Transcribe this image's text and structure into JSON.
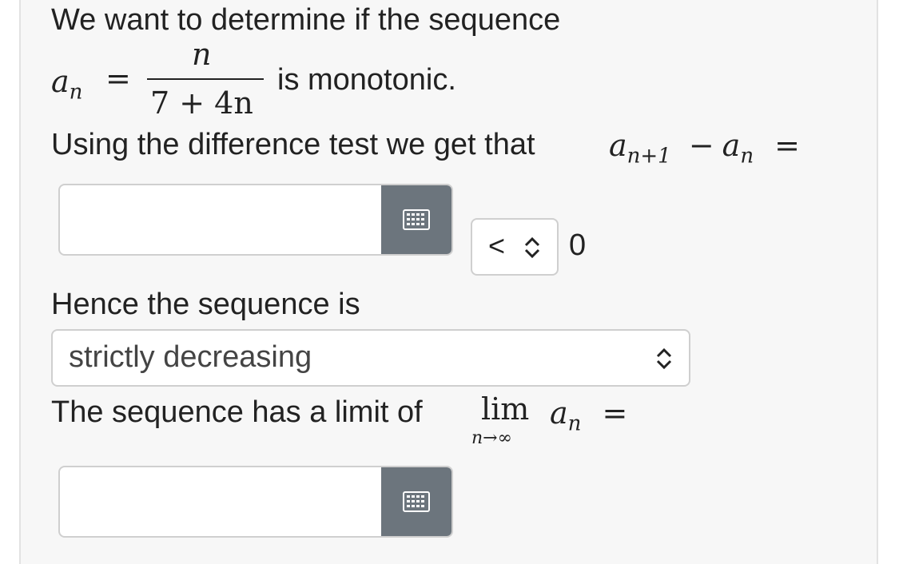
{
  "question": {
    "intro": "We want to determine if the sequence",
    "formula": {
      "lhs": "a",
      "lhs_sub": "n",
      "equals": "=",
      "numerator": "n",
      "denominator": "7 + 4n"
    },
    "monotonic_text": "is monotonic.",
    "difference_text": "Using the difference test we get that",
    "difference_expr": {
      "a1": "a",
      "a1_sub": "n+1",
      "minus": "−",
      "a2": "a",
      "a2_sub": "n",
      "equals": "="
    },
    "answer1": {
      "value": "",
      "placeholder": ""
    },
    "comparison": {
      "selected": "<",
      "right_value": "0"
    },
    "hence_text": "Hence the sequence is",
    "sequence_select": {
      "selected": "strictly decreasing"
    },
    "limit_text": "The sequence has a limit of",
    "limit_expr": {
      "lim": "lim",
      "under": "n→∞",
      "a": "a",
      "a_sub": "n",
      "equals": "="
    },
    "answer2": {
      "value": "",
      "placeholder": ""
    }
  },
  "icons": {
    "keyboard": "keyboard-icon",
    "updown": "up-down-chevron-icon"
  },
  "colors": {
    "panel_bg": "#f7f7f7",
    "keyboard_btn": "#6c757d",
    "input_border": "#cfcfcf"
  }
}
